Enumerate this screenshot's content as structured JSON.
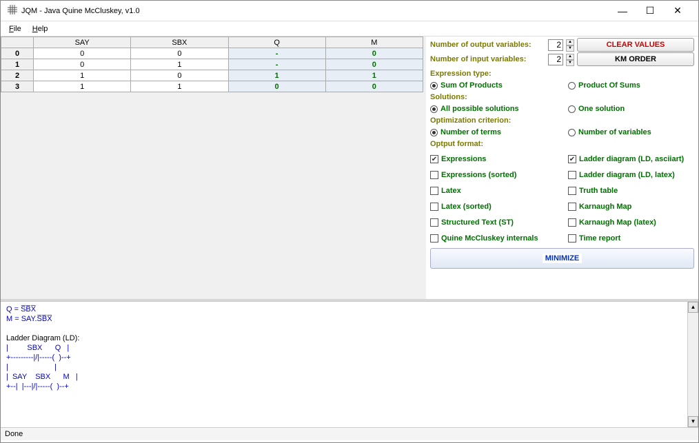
{
  "title": "JQM - Java Quine McCluskey, v1.0",
  "menu": {
    "file": "File",
    "help": "Help"
  },
  "table": {
    "headers": [
      "SAY",
      "SBX",
      "Q",
      "M"
    ],
    "rows": [
      {
        "idx": "0",
        "in": [
          "0",
          "0"
        ],
        "out": [
          "-",
          "0"
        ]
      },
      {
        "idx": "1",
        "in": [
          "0",
          "1"
        ],
        "out": [
          "-",
          "0"
        ]
      },
      {
        "idx": "2",
        "in": [
          "1",
          "0"
        ],
        "out": [
          "1",
          "1"
        ]
      },
      {
        "idx": "3",
        "in": [
          "1",
          "1"
        ],
        "out": [
          "0",
          "0"
        ]
      }
    ]
  },
  "side": {
    "num_out_lbl": "Number of output variables:",
    "num_out_val": "2",
    "num_in_lbl": "Number  of  input  variables:",
    "num_in_val": "2",
    "clear_btn": "CLEAR VALUES",
    "km_btn": "KM ORDER",
    "expr_type_lbl": "Expression type:",
    "sop": "Sum Of Products",
    "pos": "Product Of Sums",
    "solutions_lbl": "Solutions:",
    "all_sol": "All possible solutions",
    "one_sol": "One solution",
    "opt_lbl": "Optimization criterion:",
    "num_terms": "Number of terms",
    "num_vars": "Number of variables",
    "out_fmt_lbl": "Optput format:",
    "chk_expr": "Expressions",
    "chk_ld_ascii": "Ladder diagram (LD, asciiart)",
    "chk_expr_sorted": "Expressions (sorted)",
    "chk_ld_latex": "Ladder diagram (LD, latex)",
    "chk_latex": "Latex",
    "chk_truth": "Truth table",
    "chk_latex_sorted": "Latex (sorted)",
    "chk_kmap": "Karnaugh Map",
    "chk_st": "Structured Text (ST)",
    "chk_kmap_latex": "Karnaugh Map (latex)",
    "chk_qm": "Quine McCluskey internals",
    "chk_time": "Time report",
    "min_btn": "MINIMIZE"
  },
  "output": {
    "q_line": "Q = S̅B̅X̅",
    "m_line": "M = SAY.S̅B̅X̅",
    "ld_title": "Ladder Diagram (LD):",
    "l1": "|         SBX      Q   |",
    "l2": "+---------|/|-----(  )--+",
    "l3": "|                      |",
    "l4": "|  SAY    SBX      M   |",
    "l5": "+--|  |---|/|-----(  )--+"
  },
  "status": "Done"
}
